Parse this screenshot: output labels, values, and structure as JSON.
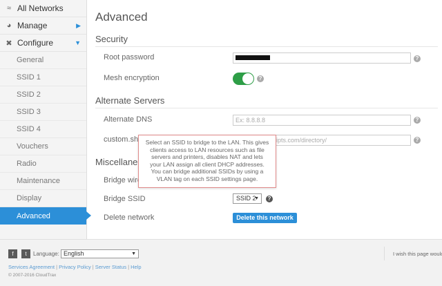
{
  "sidebar": {
    "top_items": [
      {
        "label": "All Networks",
        "icon": "wifi-icon"
      },
      {
        "label": "Manage",
        "icon": "gauge-icon"
      },
      {
        "label": "Configure",
        "icon": "tools-icon"
      }
    ],
    "items": [
      {
        "label": "General"
      },
      {
        "label": "SSID 1"
      },
      {
        "label": "SSID 2"
      },
      {
        "label": "SSID 3"
      },
      {
        "label": "SSID 4"
      },
      {
        "label": "Vouchers"
      },
      {
        "label": "Radio"
      },
      {
        "label": "Maintenance"
      },
      {
        "label": "Display"
      },
      {
        "label": "Advanced",
        "active": true
      }
    ]
  },
  "main": {
    "title": "Advanced",
    "security": {
      "heading": "Security",
      "root_password_label": "Root password",
      "mesh_encryption_label": "Mesh encryption",
      "mesh_encryption_on": true
    },
    "alternate_servers": {
      "heading": "Alternate Servers",
      "dns_label": "Alternate DNS",
      "dns_placeholder": "Ex: 8.8.8.8",
      "custom_label": "custom.sh",
      "custom_value_visible": "ipts.com/directory/"
    },
    "misc": {
      "heading_visible": "Miscellane",
      "bridge_label_visible": "Bridge wire",
      "bridge_ssid_label": "Bridge SSID",
      "bridge_ssid_value": "SSID 2",
      "delete_label": "Delete network",
      "delete_button": "Delete this network"
    },
    "tooltip": "Select an SSID to bridge to the LAN. This gives clients access to LAN resources such as file servers and printers, disables NAT and lets your LAN assign all client DHCP addresses. You can bridge additional SSIDs by using a VLAN tag on each SSID settings page.",
    "help_glyph": "?"
  },
  "footer": {
    "facebook": "f",
    "twitter": "t",
    "language_label": "Language:",
    "language_value": "English",
    "links": [
      "Services Agreement",
      "Privacy Policy",
      "Server Status",
      "Help"
    ],
    "copyright": "© 2007-2016 CloudTrax",
    "wish": "I wish this page would"
  },
  "colors": {
    "accent": "#2c8fd8",
    "toggle_on": "#2e9e47",
    "tooltip_border": "#e08a8a"
  }
}
